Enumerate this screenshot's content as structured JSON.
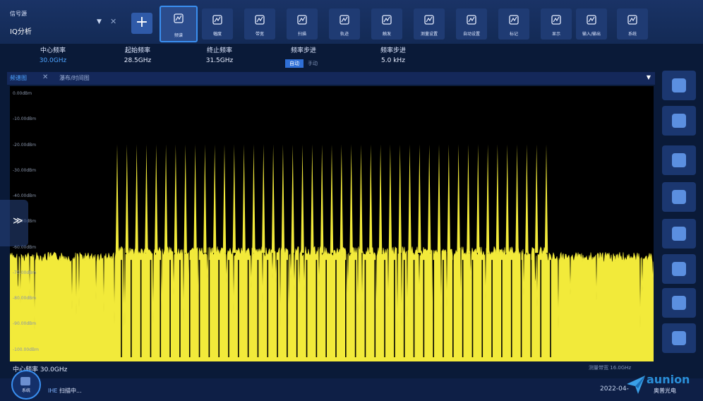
{
  "mode": {
    "small_label": "信号源",
    "name": "IQ分析"
  },
  "add_button": "+",
  "toolbar": [
    {
      "label": "频谱",
      "icon": "spectrum-icon",
      "active": true
    },
    {
      "label": "幅度",
      "icon": "amplitude-icon"
    },
    {
      "label": "带宽",
      "icon": "bandwidth-icon"
    },
    {
      "label": "扫描",
      "icon": "sweep-icon"
    },
    {
      "label": "轨迹",
      "icon": "trace-icon"
    },
    {
      "label": "触发",
      "icon": "trigger-icon"
    },
    {
      "label": "测量设置",
      "icon": "measure-setup-icon"
    },
    {
      "label": "自动设置",
      "icon": "auto-setup-icon"
    },
    {
      "label": "标记",
      "icon": "marker-icon"
    },
    {
      "label": "显示",
      "icon": "display-icon"
    },
    {
      "label": "输入/输出",
      "icon": "input-output-icon"
    },
    {
      "label": "系统",
      "icon": "system-icon"
    }
  ],
  "params": {
    "center_freq": {
      "label": "中心频率",
      "value": "30.0GHz"
    },
    "start_freq": {
      "label": "起始频率",
      "value": "28.5GHz"
    },
    "stop_freq": {
      "label": "终止频率",
      "value": "31.5GHz"
    },
    "freq_step_mode": {
      "label": "频率步进",
      "options": [
        "自动",
        "手动"
      ],
      "selected": "自动"
    },
    "freq_step": {
      "label": "频率步进",
      "value": "5.0 kHz"
    }
  },
  "tabs": {
    "active": "频谱图",
    "second": "瀑布/时间图"
  },
  "chart_data": {
    "type": "line",
    "y_tick_labels": [
      "0.00dBm",
      "-10.00dBm",
      "-20.00dBm",
      "-30.00dBm",
      "-40.00dBm",
      "-50.00dBm",
      "-60.00dBm",
      "-70.00dBm",
      "-80.00dBm",
      "-90.00dBm",
      "-100.00dBm"
    ],
    "ylim": [
      -100,
      0
    ],
    "xlim_GHz": [
      28.5,
      31.5
    ],
    "noise_floor_dBm": -64,
    "comb_region_GHz": [
      29.0,
      31.0
    ],
    "comb_tone_count": 45,
    "comb_tone_level_dBm": -20,
    "trace_color": "#f2ea3a",
    "x_left_label": "中心频率 30.0GHz",
    "x_right_label": "测量带宽",
    "x_right_value": "16.0GHz"
  },
  "right_panel": [
    "panel-icon-1",
    "panel-icon-2",
    "panel-icon-3",
    "panel-icon-4",
    "panel-icon-5",
    "panel-icon-6",
    "panel-icon-7",
    "panel-icon-8"
  ],
  "status": {
    "logo_label": "系统",
    "prefix": "IHE",
    "text": "扫描中..."
  },
  "datetime": "2022-04-",
  "brand": {
    "name": "aunion",
    "sub": "奥普光电"
  }
}
